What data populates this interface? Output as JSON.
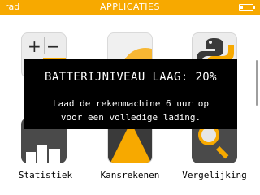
{
  "header": {
    "mode": "rad",
    "title": "APPLICATIES",
    "battery_icon": "battery-icon",
    "battery_level": 0.2
  },
  "apps": [
    {
      "name": "calculation",
      "label": "",
      "icon": "calculation-icon"
    },
    {
      "name": "grapher",
      "label": "",
      "icon": "grapher-icon"
    },
    {
      "name": "python",
      "label": "",
      "icon": "python-icon"
    },
    {
      "name": "statistics",
      "label": "Statistiek",
      "icon": "statistics-icon"
    },
    {
      "name": "probability",
      "label": "Kansrekenen",
      "icon": "probability-icon"
    },
    {
      "name": "solver",
      "label": "Vergelijking",
      "icon": "solver-icon"
    }
  ],
  "popup": {
    "title": "BATTERIJNIVEAU LAAG: 20%",
    "message_line1": "Laad de rekenmachine 6 uur op",
    "message_line2": "voor een volledige lading."
  },
  "colors": {
    "accent": "#f7a900",
    "popup_bg": "#000000",
    "popup_text": "#ffffff"
  }
}
